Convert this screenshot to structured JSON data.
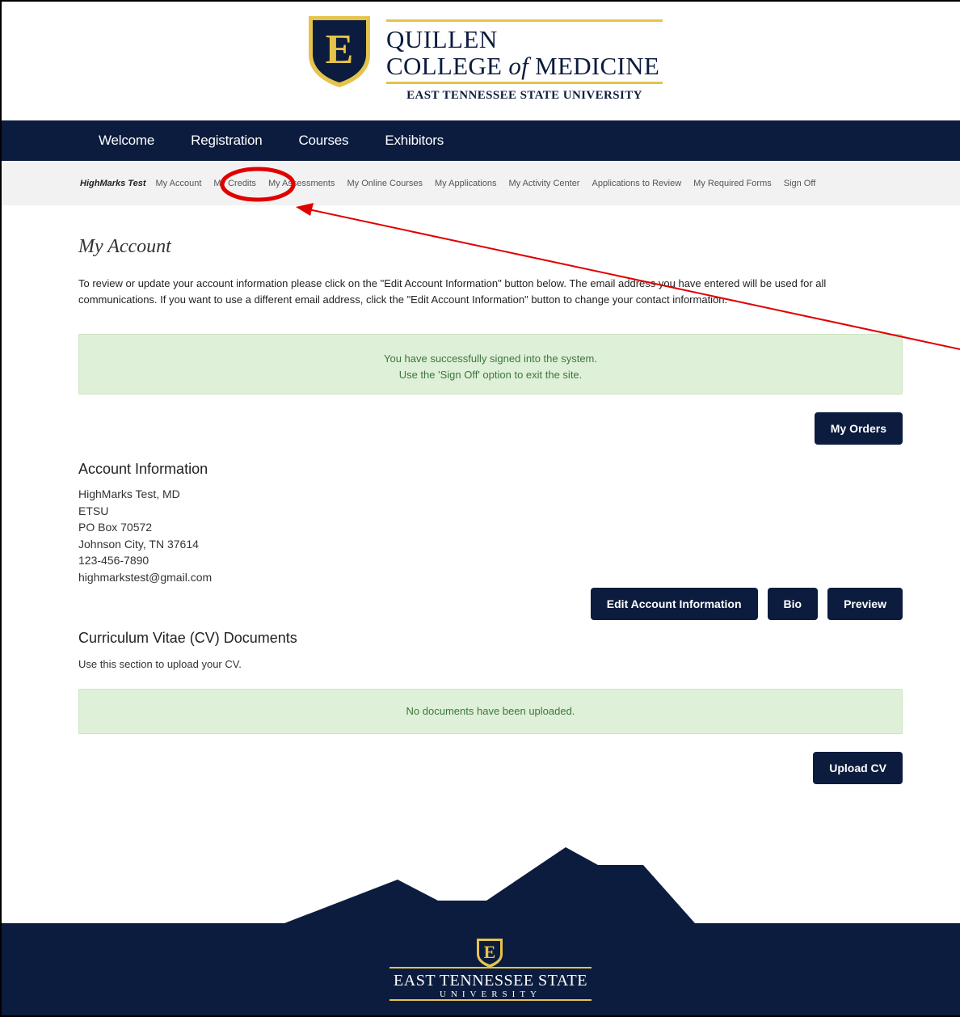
{
  "brand": {
    "line1": "QUILLEN",
    "line2_pre": "COLLEGE ",
    "line2_of": "of",
    "line2_post": " MEDICINE",
    "line3": "EAST TENNESSEE STATE UNIVERSITY",
    "shield_letter": "E"
  },
  "mainnav": [
    "Welcome",
    "Registration",
    "Courses",
    "Exhibitors"
  ],
  "subnav": {
    "user": "HighMarks Test",
    "items": [
      "My Account",
      "My Credits",
      "My Assessments",
      "My Online Courses",
      "My Applications",
      "My Activity Center",
      "Applications to Review",
      "My Required Forms",
      "Sign Off"
    ]
  },
  "page": {
    "title": "My Account",
    "intro": "To review or update your account information please click on the \"Edit Account Information\" button below. The email address you have entered will be used for all communications. If you want to use a different email address, click the \"Edit Account Information\" button to change your contact information.",
    "signed_in_line1": "You have successfully signed into the system.",
    "signed_in_line2": "Use the 'Sign Off' option to exit the site.",
    "my_orders": "My Orders"
  },
  "account": {
    "heading": "Account Information",
    "name": "HighMarks Test, MD",
    "org": "ETSU",
    "address": "PO Box 70572",
    "city": "Johnson City, TN 37614",
    "phone": "123-456-7890",
    "email": "highmarkstest@gmail.com",
    "edit_button": "Edit Account Information",
    "bio_button": "Bio",
    "preview_button": "Preview"
  },
  "cv": {
    "heading": "Curriculum Vitae (CV) Documents",
    "description": "Use this section to upload your CV.",
    "empty": "No documents have been uploaded.",
    "upload_button": "Upload CV"
  },
  "footer": {
    "line1": "EAST TENNESSEE STATE",
    "line2": "UNIVERSITY",
    "shield_letter": "E"
  },
  "colors": {
    "navy": "#0c1c3e",
    "gold": "#e6c34a",
    "success_bg": "#dff0d8",
    "success_text": "#3c763d",
    "annotation_red": "#e00000"
  }
}
